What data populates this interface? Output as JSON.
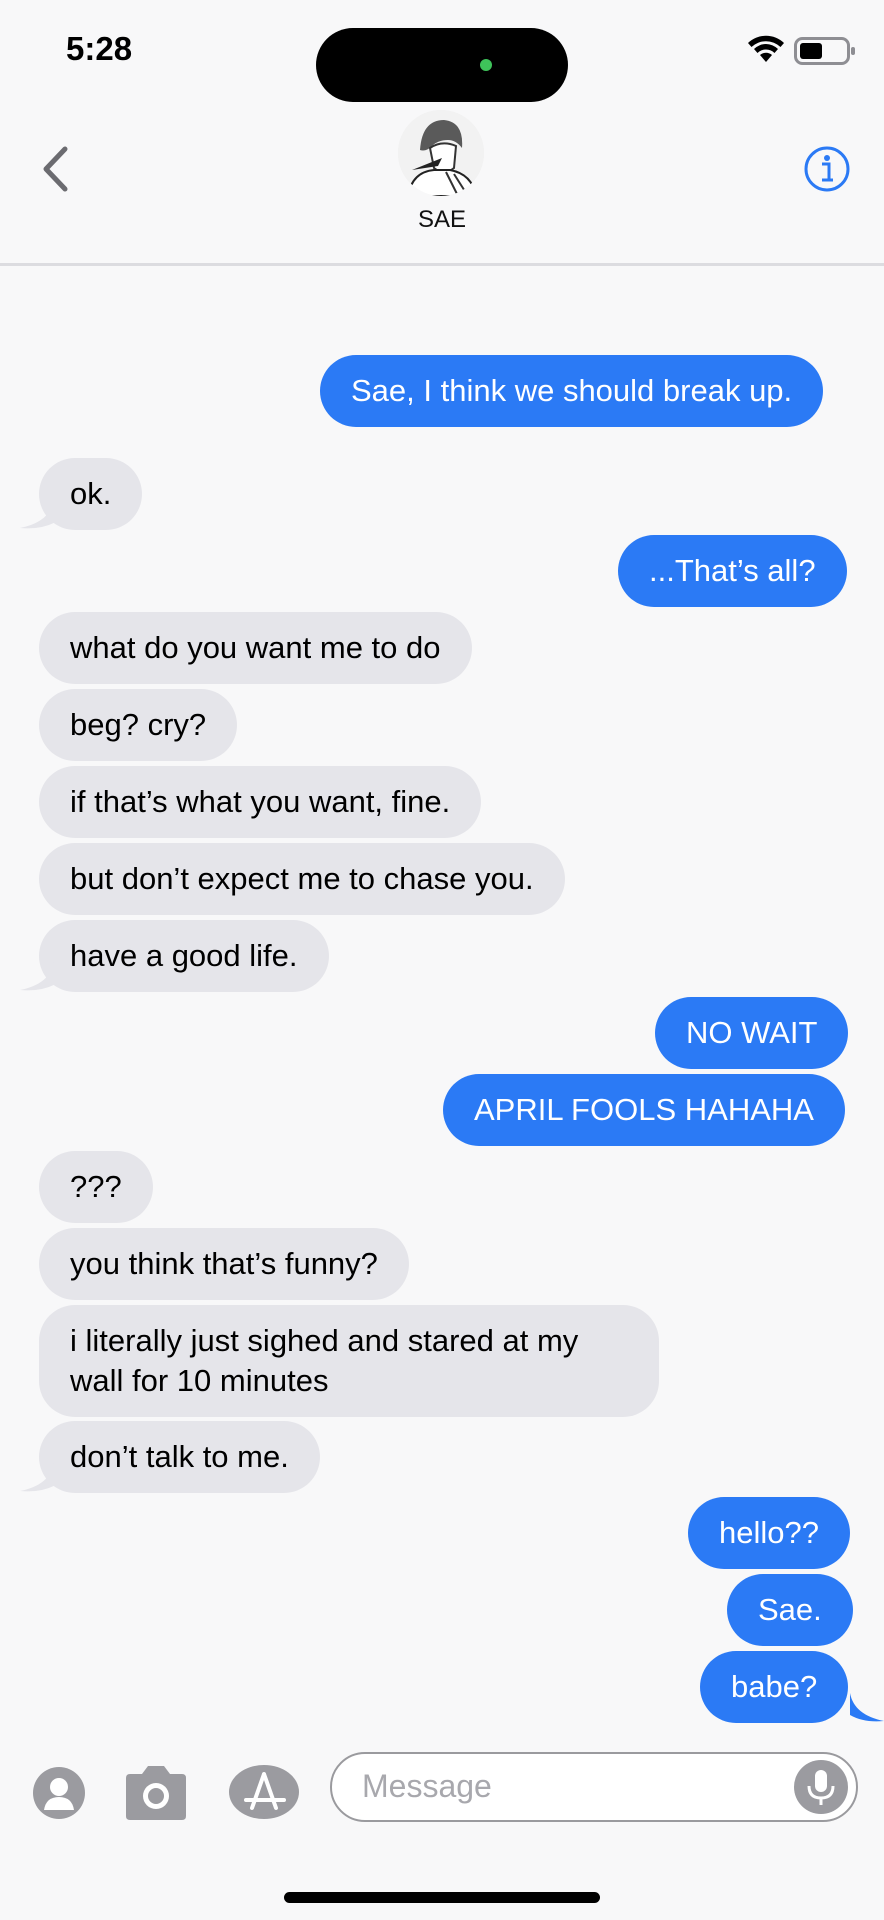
{
  "status_bar": {
    "time": "5:28"
  },
  "contact": {
    "name": "SAE"
  },
  "messages": [
    {
      "text": "Sae, I think we should break up.",
      "side": "sent"
    },
    {
      "text": "ok.",
      "side": "received"
    },
    {
      "text": "...That’s all?",
      "side": "sent"
    },
    {
      "text": "what do you want me to do",
      "side": "received"
    },
    {
      "text": "beg? cry?",
      "side": "received"
    },
    {
      "text": "if that’s what you want, fine.",
      "side": "received"
    },
    {
      "text": "but don’t expect me to chase you.",
      "side": "received"
    },
    {
      "text": "have a good life.",
      "side": "received"
    },
    {
      "text": "NO WAIT",
      "side": "sent"
    },
    {
      "text": "APRIL FOOLS HAHAHA",
      "side": "sent"
    },
    {
      "text": "???",
      "side": "received"
    },
    {
      "text": "you think that’s funny?",
      "side": "received"
    },
    {
      "text": "i literally just sighed and stared at my wall for 10 minutes",
      "side": "received"
    },
    {
      "text": "don’t talk to me.",
      "side": "received"
    },
    {
      "text": "hello??",
      "side": "sent"
    },
    {
      "text": "Sae.",
      "side": "sent"
    },
    {
      "text": "babe?",
      "side": "sent"
    }
  ],
  "composer": {
    "placeholder": "Message"
  },
  "colors": {
    "sent_bubble": "#2b7af5",
    "received_bubble": "#e5e5ea",
    "accent": "#2b7af5"
  },
  "icons": [
    "back-chevron-icon",
    "info-icon",
    "contact-icon",
    "camera-icon",
    "app-store-icon",
    "microphone-icon",
    "wifi-icon",
    "battery-icon"
  ]
}
